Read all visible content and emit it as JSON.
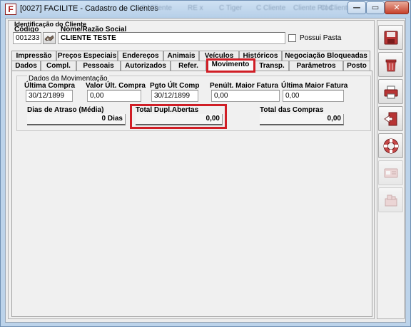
{
  "window": {
    "title": "[0027] FACILITE - Cadastro de Clientes",
    "ghost_texts": [
      "C:\\Cliente",
      "RE x",
      "C Tiger",
      "C Cliente",
      "Cliente Prod",
      "Cl Cliente 8"
    ],
    "controls": {
      "minimize": "—",
      "maximize": "▭",
      "close": "✕"
    }
  },
  "client": {
    "section_label": "Identificação do Cliente",
    "code_label": "Código",
    "name_label": "Nome/Razão Social",
    "code_value": "001233",
    "name_value": "CLIENTE TESTE",
    "possui_pasta_label": "Possui Pasta",
    "possui_pasta_checked": false
  },
  "tabs": {
    "row1": [
      "Impressão",
      "Preços Especiais",
      "Endereços",
      "Animais",
      "Veículos",
      "Históricos",
      "Negociação Bloqueadas"
    ],
    "row2": [
      "Dados",
      "Compl.",
      "Pessoais",
      "Autorizados",
      "Refer.",
      "Movimento",
      "Transp.",
      "Parâmetros",
      "Posto"
    ],
    "active": "Movimento"
  },
  "movimento": {
    "group_title": "Dados da Movimentação",
    "ultima_compra_label": "Última Compra",
    "ultima_compra_value": "30/12/1899",
    "valor_ult_compra_label": "Valor Últ. Compra",
    "valor_ult_compra_value": "0,00",
    "pgto_ult_comp_label": "Pgto Últ Comp",
    "pgto_ult_comp_value": "30/12/1899",
    "penult_maior_fatura_label": "Penúlt. Maior Fatura",
    "penult_maior_fatura_value": "0,00",
    "ultima_maior_fatura_label": "Última Maior Fatura",
    "ultima_maior_fatura_value": "0,00",
    "dias_atraso_label": "Dias de Atraso (Média)",
    "dias_atraso_value": "0 Dias",
    "total_dupl_abertas_label": "Total Dupl.Abertas",
    "total_dupl_abertas_value": "0,00",
    "total_compras_label": "Total das Compras",
    "total_compras_value": "0,00"
  },
  "colors": {
    "highlight": "#d01e26",
    "title_bar": "#bcd3ea",
    "close_button": "#c6402b"
  },
  "sidebar_icons": [
    "save-icon",
    "trash-icon",
    "printer-icon",
    "exit-icon",
    "lifebuoy-icon",
    "card-icon",
    "puzzle-icon"
  ]
}
